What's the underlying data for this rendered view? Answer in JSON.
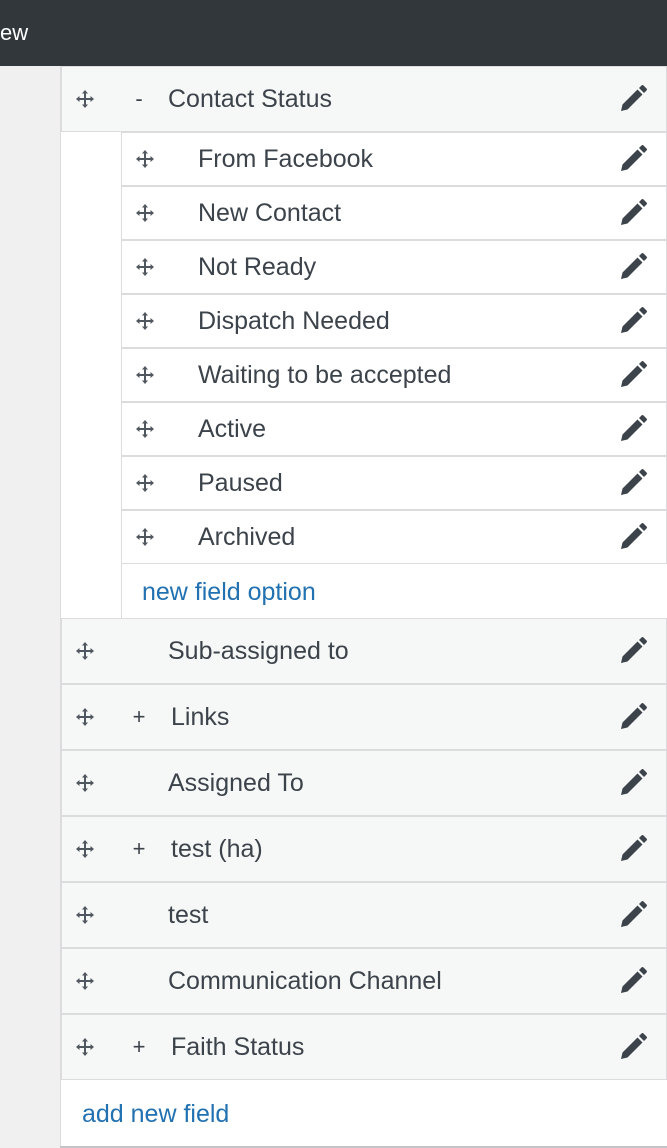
{
  "topbar": {
    "label": "ew"
  },
  "contact_status": {
    "toggle": "-",
    "label": "Contact Status"
  },
  "options": [
    {
      "label": "From Facebook"
    },
    {
      "label": "New Contact"
    },
    {
      "label": "Not Ready"
    },
    {
      "label": "Dispatch Needed"
    },
    {
      "label": "Waiting to be accepted"
    },
    {
      "label": "Active"
    },
    {
      "label": "Paused"
    },
    {
      "label": "Archived"
    }
  ],
  "new_option_label": "new field option",
  "fields": [
    {
      "toggle": "",
      "label": "Sub-assigned to"
    },
    {
      "toggle": "+",
      "label": "Links"
    },
    {
      "toggle": "",
      "label": "Assigned To"
    },
    {
      "toggle": "+",
      "label": "test (ha)"
    },
    {
      "toggle": "",
      "label": "test"
    },
    {
      "toggle": "",
      "label": "Communication Channel"
    },
    {
      "toggle": "+",
      "label": "Faith Status"
    }
  ],
  "add_field_label": "add new field",
  "icons": {
    "drag": "move-arrows-icon",
    "edit": "pencil-icon"
  },
  "colors": {
    "topbar": "#32373c",
    "link": "#2271b1",
    "text": "#3c434a"
  }
}
